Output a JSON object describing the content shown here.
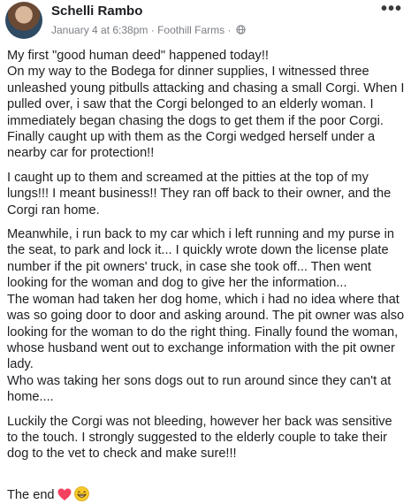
{
  "post": {
    "author": "Schelli Rambo",
    "date": "January 4 at 6:38pm",
    "separator1": "·",
    "location": "Foothill Farms",
    "separator2": "·",
    "privacy_icon": "globe-icon",
    "more_icon": "more-options-icon",
    "paragraphs": [
      "My first \"good human deed\" happened today!!\nOn my way to the Bodega for dinner supplies, I witnessed three unleashed young pitbulls attacking and chasing a small Corgi. When I pulled over, i saw that the Corgi belonged to an elderly woman. I immediately began chasing the dogs to get them if the poor Corgi. Finally caught up with them as the Corgi wedged herself under a nearby car for protection!!",
      "I caught up to them and screamed at the pitties at the top of my lungs!!! I meant business!! They ran off back to their owner, and the Corgi ran home.",
      "Meanwhile, i run back to my car which i left running and my purse in the seat, to park and lock it... I quickly wrote down the license plate number if the pit owners' truck, in case she took off... Then went looking for the woman and dog to give her the information...\nThe woman had taken her dog home, which i had no idea where that was so going door to door and asking around. The pit owner was also looking for the woman to do the right thing. Finally found the woman, whose husband went out to exchange information with the pit owner lady.\nWho was taking her sons dogs out to run around since they can't at home....",
      "Luckily the Corgi was not bleeding, however her back was sensitive to the touch. I strongly suggested to the elderly couple to take their dog to the vet to check and make sure!!!"
    ],
    "closing": "The end",
    "closing_emojis": [
      "heart-emoji",
      "grinning-face-emoji"
    ]
  },
  "colors": {
    "heart": "#f3425f",
    "emoji_face": "#f7c928",
    "meta_text": "#7a7e84"
  }
}
